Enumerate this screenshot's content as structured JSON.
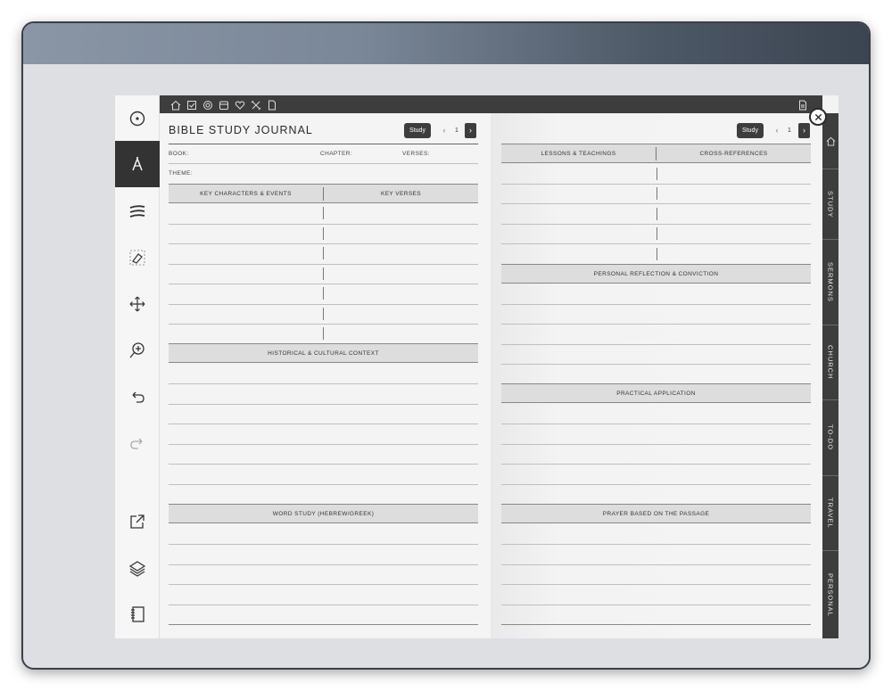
{
  "left_page": {
    "title": "BIBLE STUDY JOURNAL",
    "study_button": "Study",
    "page_prev": "‹",
    "page_number": "1",
    "page_next": "›",
    "fields": {
      "book": "BOOK:",
      "chapter": "CHAPTER:",
      "verses": "VERSES:",
      "theme": "THEME:"
    },
    "headers": {
      "key_characters": "KEY CHARACTERS & EVENTS",
      "key_verses": "KEY VERSES",
      "historical": "HISTORICAL & CULTURAL CONTEXT",
      "word_study": "WORD STUDY (HEBREW/GREEK)"
    }
  },
  "right_page": {
    "study_button": "Study",
    "page_prev": "‹",
    "page_number": "1",
    "page_next": "›",
    "headers": {
      "lessons": "LESSONS & TEACHINGS",
      "cross_references": "CROSS-REFERENCES",
      "reflection": "PERSONAL REFLECTION & CONVICTION",
      "application": "PRACTICAL APPLICATION",
      "prayer": "PRAYER BASED ON THE PASSAGE"
    }
  },
  "tabs": [
    "STUDY",
    "SERMONS",
    "CHURCH",
    "TO-DO",
    "TRAVEL",
    "PERSONAL"
  ],
  "toolbar_icons": [
    "circle-dot-icon",
    "pen-icon",
    "brush-icon",
    "eraser-icon",
    "move-icon",
    "zoom-icon",
    "undo-icon",
    "redo-icon",
    "export-icon",
    "layers-icon",
    "notebook-icon"
  ],
  "topbar_icons": [
    "home-icon",
    "checkbox-icon",
    "target-icon",
    "calendar-icon",
    "heart-icon",
    "tools-icon",
    "document-icon",
    "page-icon"
  ],
  "colors": {
    "dark": "#3d3d3d",
    "paper": "#f4f4f4",
    "header_fill": "#dddddd"
  }
}
